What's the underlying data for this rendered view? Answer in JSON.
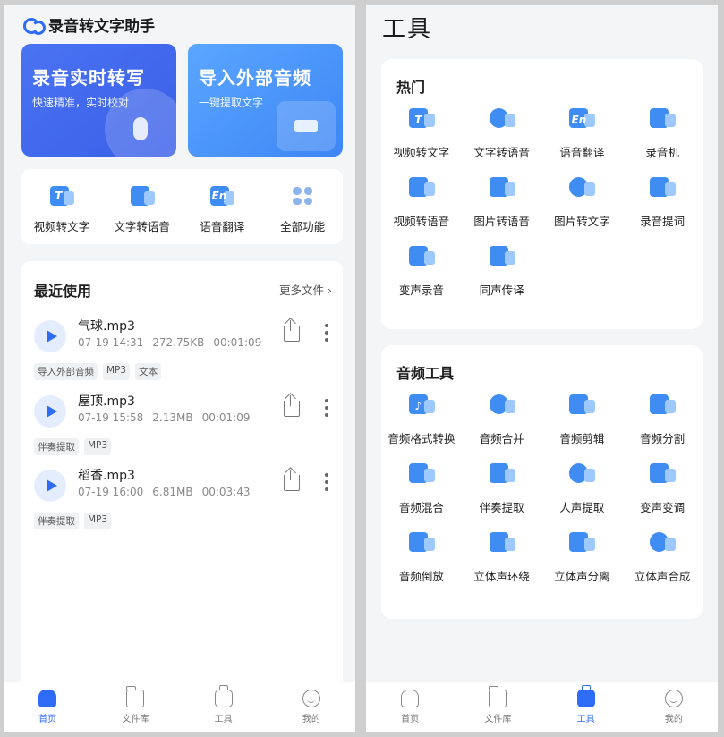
{
  "left": {
    "app_title": "录音转文字助手",
    "hero": [
      {
        "title": "录音实时转写",
        "subtitle": "快速精准，实时校对"
      },
      {
        "title": "导入外部音频",
        "subtitle": "一键提取文字"
      }
    ],
    "quick": [
      {
        "label": "视频转文字",
        "icon": "video-text-icon",
        "glyph": "T"
      },
      {
        "label": "文字转语音",
        "icon": "text-speech-icon",
        "glyph": ""
      },
      {
        "label": "语音翻译",
        "icon": "translate-icon",
        "glyph": "En"
      },
      {
        "label": "全部功能",
        "icon": "all-functions-icon",
        "glyph": ""
      }
    ],
    "recent": {
      "title": "最近使用",
      "more": "更多文件",
      "files": [
        {
          "name": "气球.mp3",
          "date": "07-19 14:31",
          "size": "272.75KB",
          "duration": "00:01:09",
          "tags": [
            "导入外部音频",
            "MP3",
            "文本"
          ]
        },
        {
          "name": "屋顶.mp3",
          "date": "07-19 15:58",
          "size": "2.13MB",
          "duration": "00:01:09",
          "tags": [
            "伴奏提取",
            "MP3"
          ]
        },
        {
          "name": "稻香.mp3",
          "date": "07-19 16:00",
          "size": "6.81MB",
          "duration": "00:03:43",
          "tags": [
            "伴奏提取",
            "MP3"
          ]
        }
      ]
    }
  },
  "tabs": [
    {
      "label": "首页",
      "icon": "home-icon"
    },
    {
      "label": "文件库",
      "icon": "folder-icon"
    },
    {
      "label": "工具",
      "icon": "toolbox-icon"
    },
    {
      "label": "我的",
      "icon": "profile-icon"
    }
  ],
  "right": {
    "page_title": "工具",
    "sections": [
      {
        "title": "热门",
        "items": [
          {
            "label": "视频转文字",
            "glyph": "T"
          },
          {
            "label": "文字转语音",
            "glyph": ""
          },
          {
            "label": "语音翻译",
            "glyph": "En"
          },
          {
            "label": "录音机",
            "glyph": ""
          },
          {
            "label": "视频转语音",
            "glyph": ""
          },
          {
            "label": "图片转语音",
            "glyph": ""
          },
          {
            "label": "图片转文字",
            "glyph": ""
          },
          {
            "label": "录音提词",
            "glyph": ""
          },
          {
            "label": "变声录音",
            "glyph": ""
          },
          {
            "label": "同声传译",
            "glyph": ""
          }
        ]
      },
      {
        "title": "音频工具",
        "items": [
          {
            "label": "音频格式转换",
            "glyph": "♪"
          },
          {
            "label": "音频合并",
            "glyph": ""
          },
          {
            "label": "音频剪辑",
            "glyph": ""
          },
          {
            "label": "音频分割",
            "glyph": ""
          },
          {
            "label": "音频混合",
            "glyph": ""
          },
          {
            "label": "伴奏提取",
            "glyph": ""
          },
          {
            "label": "人声提取",
            "glyph": ""
          },
          {
            "label": "变声变调",
            "glyph": ""
          },
          {
            "label": "音频倒放",
            "glyph": ""
          },
          {
            "label": "立体声环绕",
            "glyph": ""
          },
          {
            "label": "立体声分离",
            "glyph": ""
          },
          {
            "label": "立体声合成",
            "glyph": ""
          }
        ]
      }
    ]
  },
  "colors": {
    "accent": "#2f6cf5",
    "hero_left": "#4a73f2",
    "hero_right": "#5aa6ff"
  }
}
